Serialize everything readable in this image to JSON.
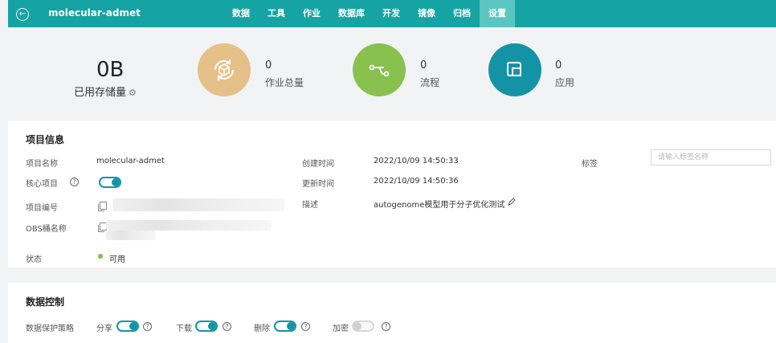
{
  "header": {
    "back_icon": "arrow-left-icon",
    "title": "molecular-admet",
    "tabs": [
      "数据",
      "工具",
      "作业",
      "数据库",
      "开发",
      "镜像",
      "归档",
      "设置"
    ],
    "active_tab": "设置"
  },
  "stats": {
    "storage_value": "0B",
    "storage_label": "已用存储量",
    "storage_icon": "settings-icon",
    "jobs": {
      "value": "0",
      "label": "作业总量",
      "icon": "cycle-box-icon",
      "color": "#e5c088"
    },
    "flows": {
      "value": "0",
      "label": "流程",
      "icon": "workflow-icon",
      "color": "#88c14e"
    },
    "apps": {
      "value": "0",
      "label": "应用",
      "icon": "app-window-icon",
      "color": "#1593a6"
    }
  },
  "project_info": {
    "title": "项目信息",
    "name_label": "项目名称",
    "name_value": "molecular-admet",
    "core_label": "核心项目",
    "core_on": true,
    "id_label": "项目编号",
    "obs_label": "OBS桶名称",
    "status_label": "状态",
    "status_value": "可用",
    "status_color": "#7cc242",
    "created_label": "创建时间",
    "created_value": "2022/10/09 14:50:33",
    "updated_label": "更新时间",
    "updated_value": "2022/10/09 14:50:36",
    "desc_label": "描述",
    "desc_value": "autogenome模型用于分子优化测试",
    "tag_label": "标签",
    "tag_placeholder": "请输入标签名称"
  },
  "data_control": {
    "title": "数据控制",
    "policy_label": "数据保护策略",
    "toggles": [
      {
        "label": "分享",
        "on": true
      },
      {
        "label": "下载",
        "on": true
      },
      {
        "label": "删除",
        "on": true
      },
      {
        "label": "加密",
        "on": false
      }
    ]
  },
  "colors": {
    "primary": "#16a3a3",
    "active_tab": "#5bc5c1",
    "toggle": "#1593a6"
  }
}
